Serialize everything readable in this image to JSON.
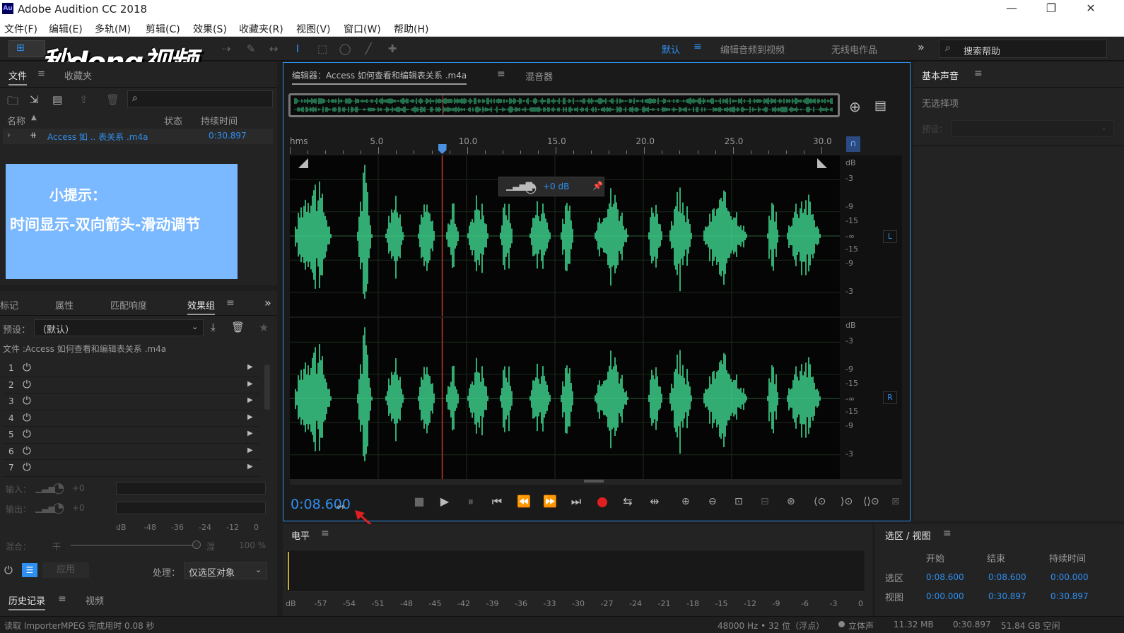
{
  "window": {
    "title": "Adobe Audition CC 2018",
    "logo": "Au",
    "min": "—",
    "restore": "❐",
    "close": "✕"
  },
  "menu": [
    "文件(F)",
    "编辑(E)",
    "多轨(M)",
    "剪辑(C)",
    "效果(S)",
    "收藏夹(R)",
    "视图(V)",
    "窗口(W)",
    "帮助(H)"
  ],
  "workspaces": {
    "default": "默认",
    "edit_video": "编辑音频到视频",
    "radio": "无线电作品",
    "search_placeholder": "搜索帮助"
  },
  "watermark": "秒dong视频",
  "files_panel": {
    "tabs": [
      "文件",
      "收藏夹"
    ],
    "columns": {
      "name": "名称",
      "status": "状态",
      "duration": "持续时间"
    },
    "file": {
      "name": "Access 如 .. 表关系 .m4a",
      "duration": "0:30.897"
    }
  },
  "tip": {
    "title": "小提示：",
    "body": "时间显示-双向箭头-滑动调节"
  },
  "effects_panel": {
    "tabs": [
      "标记",
      "属性",
      "匹配响度",
      "效果组"
    ],
    "preset_label": "预设：",
    "preset_value": "（默认）",
    "file_label": "文件 :Access 如何查看和编辑表关系 .m4a",
    "rows": [
      "1",
      "2",
      "3",
      "4",
      "5",
      "6",
      "7"
    ],
    "input_label": "输入：",
    "output_label": "输出：",
    "input_val": "+0",
    "output_val": "+0",
    "meter_ticks": [
      "dB",
      "-48",
      "-36",
      "-24",
      "-12",
      "0"
    ],
    "mix_label": "混合：",
    "mix_dry": "干",
    "mix_wet": "湿",
    "mix_val": "100 %",
    "apply": "应用",
    "process_label": "处理：",
    "process_value": "仅选区对象"
  },
  "history_panel": {
    "tabs": [
      "历史记录",
      "视频"
    ]
  },
  "editor": {
    "tab_label": "编辑器：Access 如何查看和编辑表关系 .m4a",
    "mixer_tab": "混音器",
    "ruler_unit": "hms",
    "ruler_labels": [
      "5.0",
      "10.0",
      "15.0",
      "20.0",
      "25.0",
      "30.0"
    ],
    "hud_gain": "+0 dB",
    "db_labels_top": [
      "dB",
      "-3",
      "-9",
      "-15",
      "-∞",
      "-15",
      "-9",
      "-3"
    ],
    "db_labels_bot": [
      "dB",
      "-3",
      "-9",
      "-15",
      "-∞",
      "-15",
      "-9",
      "-3"
    ],
    "channel_L": "L",
    "channel_R": "R",
    "time_display": "0:08.600",
    "playhead_seconds": 8.6,
    "total_seconds": 30.897
  },
  "basic_sound": {
    "title": "基本声音",
    "no_selection": "无选择项",
    "preset_label": "预设："
  },
  "level_panel": {
    "title": "电平",
    "ticks": [
      "dB",
      "-57",
      "-54",
      "-51",
      "-48",
      "-45",
      "-42",
      "-39",
      "-36",
      "-33",
      "-30",
      "-27",
      "-24",
      "-21",
      "-18",
      "-15",
      "-12",
      "-9",
      "-6",
      "-3",
      "0"
    ]
  },
  "selection_view": {
    "title": "选区 / 视图",
    "headers": [
      "开始",
      "结束",
      "持续时间"
    ],
    "rows": [
      {
        "label": "选区",
        "start": "0:08.600",
        "end": "0:08.600",
        "duration": "0:00.000"
      },
      {
        "label": "视图",
        "start": "0:00.000",
        "end": "0:30.897",
        "duration": "0:30.897"
      }
    ]
  },
  "status_bar": {
    "left": "读取 ImporterMPEG 完成用时 0.08 秒",
    "format": "48000 Hz • 32 位（浮点）",
    "channels": "立体声",
    "size": "11.32 MB",
    "duration": "0:30.897",
    "free": "51.84 GB 空闲"
  },
  "colors": {
    "accent": "#2f8ff0",
    "waveform": "#3ed68e",
    "playhead": "#c0392b",
    "record": "#e02020",
    "tip_bg": "#7ab8ff"
  }
}
